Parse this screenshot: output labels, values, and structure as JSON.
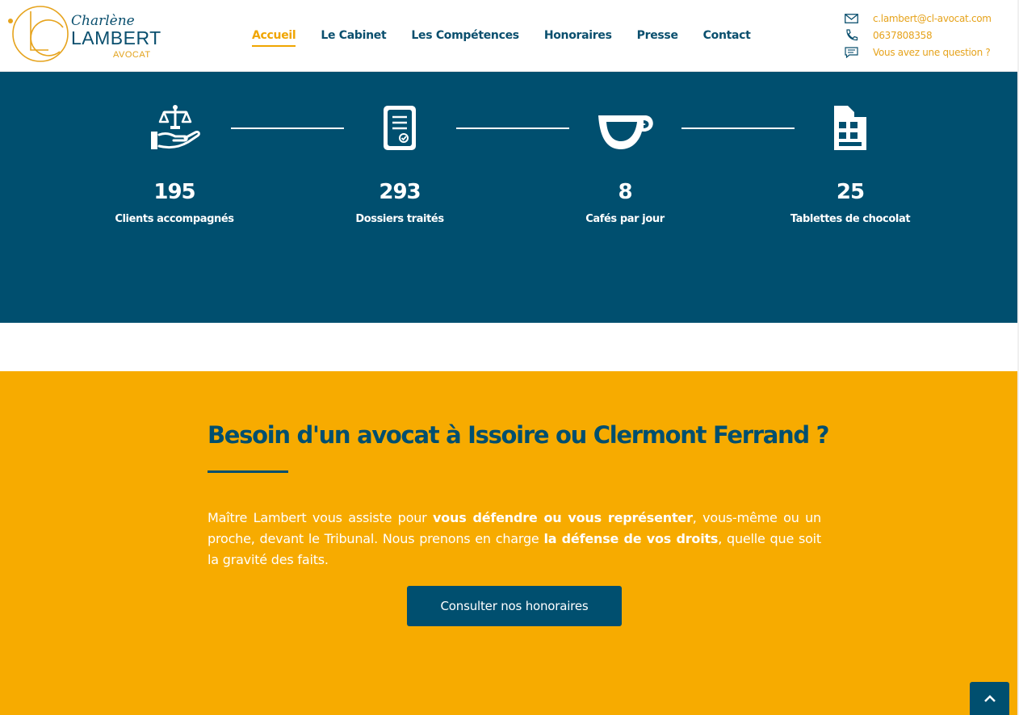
{
  "logo": {
    "script": "Charlène",
    "name": "LAMBERT",
    "sub": "AVOCAT"
  },
  "nav": {
    "items": [
      {
        "label": "Accueil",
        "active": true
      },
      {
        "label": "Le Cabinet",
        "active": false
      },
      {
        "label": "Les Compétences",
        "active": false
      },
      {
        "label": "Honoraires",
        "active": false
      },
      {
        "label": "Presse",
        "active": false
      },
      {
        "label": "Contact",
        "active": false
      }
    ]
  },
  "contact": {
    "email": "c.lambert@cl-avocat.com",
    "phone": "0637808358",
    "question": "Vous avez une question ?"
  },
  "stats": [
    {
      "icon": "justice-hand-icon",
      "number": "195",
      "label": "Clients accompagnés"
    },
    {
      "icon": "document-check-icon",
      "number": "293",
      "label": "Dossiers traités"
    },
    {
      "icon": "coffee-cup-icon",
      "number": "8",
      "label": "Cafés par jour"
    },
    {
      "icon": "chocolate-bar-icon",
      "number": "25",
      "label": "Tablettes de chocolat"
    }
  ],
  "cta": {
    "title": "Besoin d'un avocat à Issoire ou Clermont Ferrand ?",
    "text_1": "Maître Lambert vous assiste pour ",
    "text_bold_1": "vous défendre ou vous représenter",
    "text_2": ", vous-même ou un proche, devant le Tribunal. Nous prenons en charge ",
    "text_bold_2": "la défense de vos droits",
    "text_3": ", quelle que soit la gravité des faits.",
    "button": "Consulter nos honoraires"
  },
  "colors": {
    "navy": "#004f6f",
    "orange": "#f7ab00",
    "accent": "#f0a500"
  }
}
